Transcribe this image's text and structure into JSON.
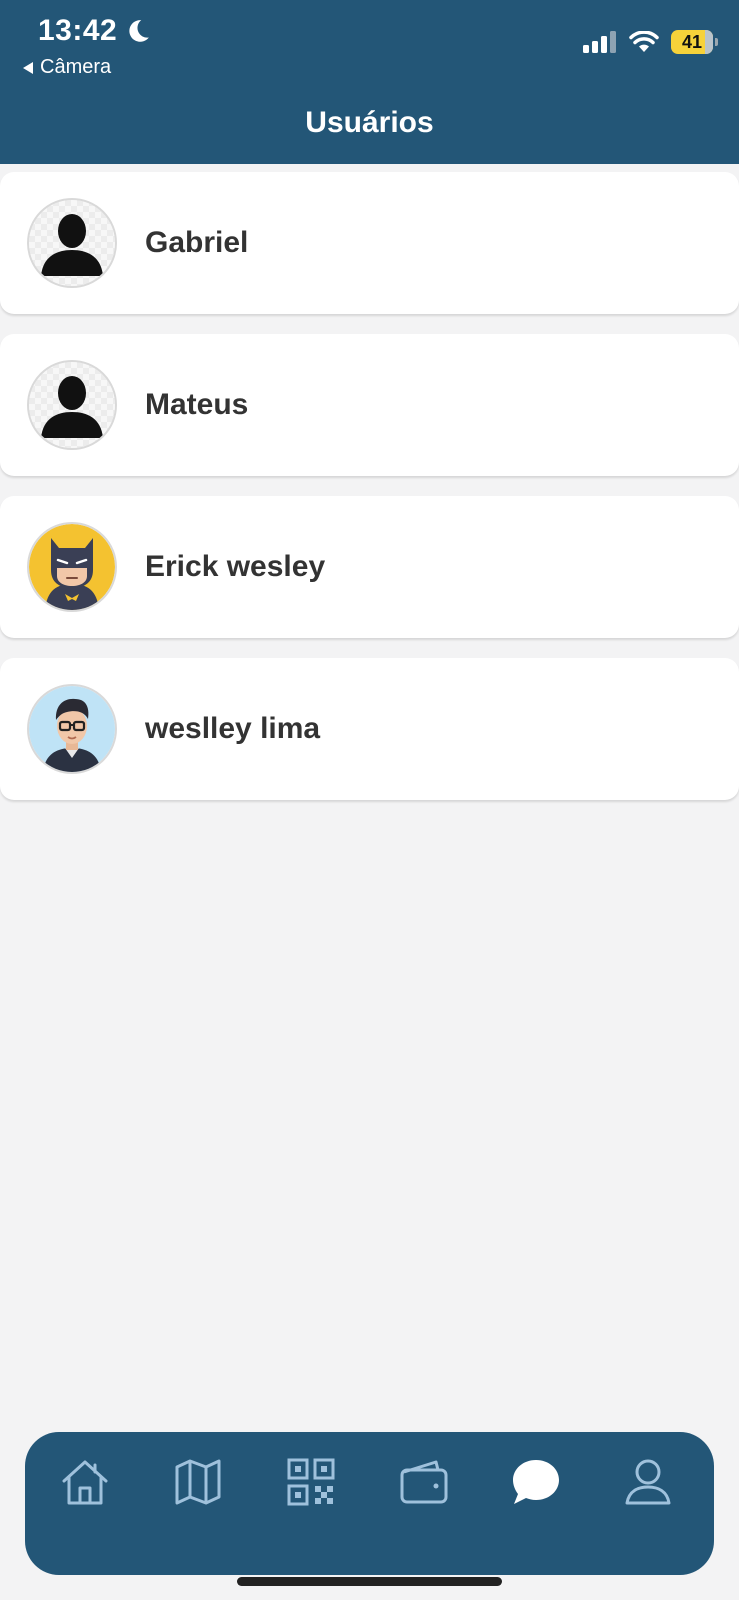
{
  "status": {
    "time": "13:42",
    "back_app": "Câmera",
    "battery": "41"
  },
  "header": {
    "title": "Usuários"
  },
  "users": [
    {
      "name": "Gabriel",
      "avatar": "person-silhouette-icon"
    },
    {
      "name": "Mateus",
      "avatar": "person-silhouette-icon"
    },
    {
      "name": "Erick wesley",
      "avatar": "batman-avatar"
    },
    {
      "name": "weslley lima",
      "avatar": "man-glasses-avatar"
    }
  ],
  "tabs": [
    {
      "icon": "home-icon",
      "active": false
    },
    {
      "icon": "map-icon",
      "active": false
    },
    {
      "icon": "qr-code-icon",
      "active": false
    },
    {
      "icon": "wallet-icon",
      "active": false
    },
    {
      "icon": "chat-icon",
      "active": true
    },
    {
      "icon": "profile-icon",
      "active": false
    }
  ],
  "colors": {
    "primary": "#235677",
    "background": "#f3f3f4",
    "card": "#ffffff",
    "battery": "#f6d23a"
  }
}
